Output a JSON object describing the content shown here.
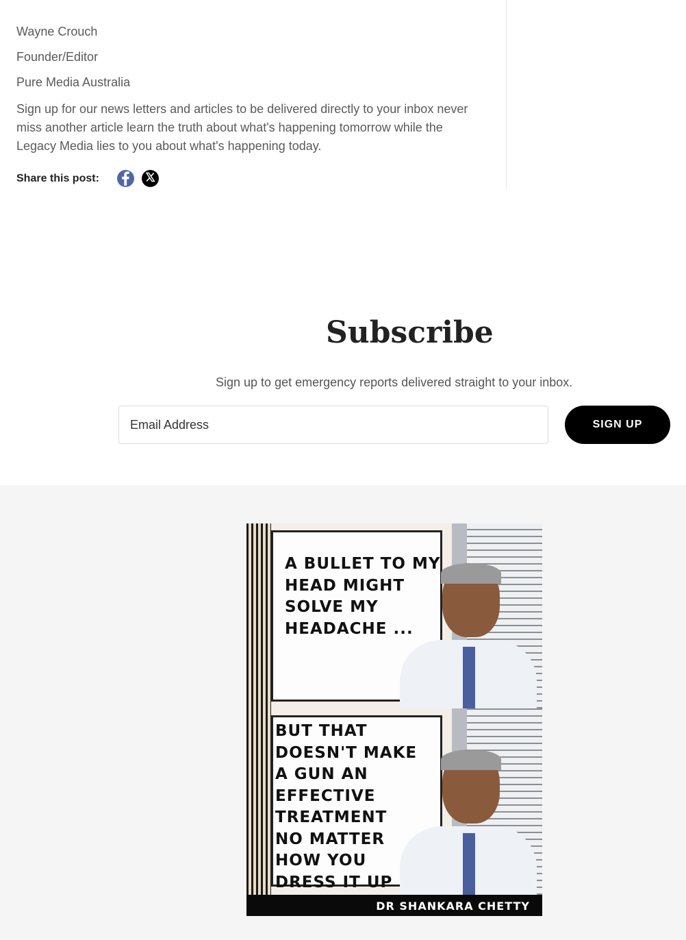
{
  "author": {
    "name": "Wayne Crouch",
    "role": "Founder/Editor",
    "organization": "Pure Media Australia"
  },
  "pitch": "Sign up for our news letters and articles to be delivered directly to your inbox never miss another article learn the truth about what's happening tomorrow while the Legacy Media lies to you about what's happening today.",
  "share": {
    "label": "Share this post:",
    "buttons": [
      {
        "icon": "facebook-icon",
        "color": "#4f67a7"
      },
      {
        "icon": "x-icon",
        "color": "#000000"
      }
    ]
  },
  "subscribe": {
    "title": "Subscribe",
    "description": "Sign up to get emergency reports delivered straight to your inbox.",
    "email_placeholder": "Email Address",
    "button_label": "SIGN UP"
  },
  "featured_image": {
    "caption_top": "A BULLET TO MY\nHEAD MIGHT\nSOLVE MY\n HEADACHE ...",
    "caption_bottom": "BUT THAT\nDOESN'T MAKE\nA GUN AN\nEFFECTIVE\nTREATMENT\nNO MATTER\nHOW YOU\nDRESS IT UP",
    "credit": "DR SHANKARA CHETTY"
  }
}
